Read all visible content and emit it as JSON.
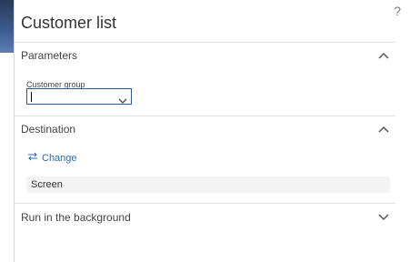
{
  "dialog": {
    "title": "Customer list",
    "help_label": "?"
  },
  "parameters": {
    "header": "Parameters",
    "customer_group_label": "Customer group",
    "customer_group_value": ""
  },
  "destination": {
    "header": "Destination",
    "change_label": "Change",
    "value": "Screen"
  },
  "background": {
    "header": "Run in the background"
  },
  "colors": {
    "accent": "#2b579a",
    "link": "#2b6cb0",
    "divider": "#e1e1e1"
  }
}
